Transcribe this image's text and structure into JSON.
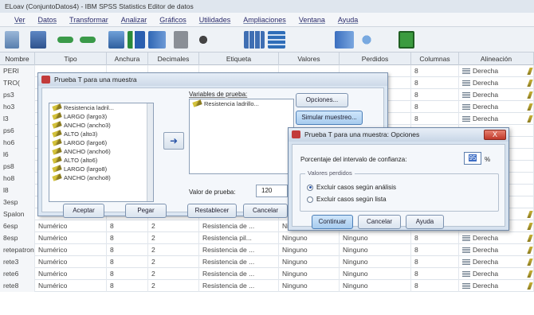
{
  "window": {
    "title": "ELoav (ConjuntoDatos4) - IBM SPSS Statistics Editor de datos"
  },
  "menu": [
    "Ver",
    "Datos",
    "Transformar",
    "Analizar",
    "Gráficos",
    "Utilidades",
    "Ampliaciones",
    "Ventana",
    "Ayuda"
  ],
  "toolbar_icons": [
    "open-icon",
    "save-icon",
    "undo-icon",
    "redo-icon",
    "goto-case-icon",
    "variables-icon",
    "chart-icon",
    "split-icon",
    "find-icon",
    "value-labels-icon",
    "weight-icon",
    "select-icon",
    "dialog-recall-icon"
  ],
  "grid": {
    "columns": [
      "Nombre",
      "Tipo",
      "Anchura",
      "Decimales",
      "Etiqueta",
      "Valores",
      "Perdidos",
      "Columnas",
      "Alineación"
    ],
    "rows": [
      {
        "name": "PERI",
        "tipo": "",
        "anchura": "",
        "decimales": "",
        "etiqueta": "",
        "valores": "",
        "perdidos": "",
        "columnas": "8",
        "alineacion": "Derecha"
      },
      {
        "name": "TRO(",
        "tipo": "",
        "anchura": "",
        "decimales": "",
        "etiqueta": "",
        "valores": "",
        "perdidos": "",
        "columnas": "8",
        "alineacion": "Derecha"
      },
      {
        "name": "ps3",
        "tipo": "",
        "anchura": "",
        "decimales": "",
        "etiqueta": "",
        "valores": "",
        "perdidos": "",
        "columnas": "8",
        "alineacion": "Derecha"
      },
      {
        "name": "ho3",
        "tipo": "",
        "anchura": "",
        "decimales": "",
        "etiqueta": "",
        "valores": "",
        "perdidos": "",
        "columnas": "8",
        "alineacion": "Derecha"
      },
      {
        "name": "l3",
        "tipo": "",
        "anchura": "",
        "decimales": "",
        "etiqueta": "",
        "valores": "",
        "perdidos": "",
        "columnas": "8",
        "alineacion": "Derecha"
      },
      {
        "name": "ps6",
        "tipo": "",
        "anchura": "",
        "decimales": "",
        "etiqueta": "",
        "valores": "",
        "perdidos": "",
        "columnas": "",
        "alineacion": ""
      },
      {
        "name": "ho6",
        "tipo": "",
        "anchura": "",
        "decimales": "",
        "etiqueta": "",
        "valores": "",
        "perdidos": "",
        "columnas": "",
        "alineacion": ""
      },
      {
        "name": "l6",
        "tipo": "",
        "anchura": "",
        "decimales": "",
        "etiqueta": "",
        "valores": "",
        "perdidos": "",
        "columnas": "",
        "alineacion": ""
      },
      {
        "name": "ps8",
        "tipo": "",
        "anchura": "",
        "decimales": "",
        "etiqueta": "",
        "valores": "",
        "perdidos": "",
        "columnas": "",
        "alineacion": ""
      },
      {
        "name": "ho8",
        "tipo": "",
        "anchura": "",
        "decimales": "",
        "etiqueta": "",
        "valores": "",
        "perdidos": "",
        "columnas": "",
        "alineacion": ""
      },
      {
        "name": "l8",
        "tipo": "",
        "anchura": "",
        "decimales": "",
        "etiqueta": "",
        "valores": "",
        "perdidos": "",
        "columnas": "",
        "alineacion": ""
      },
      {
        "name": "3esp",
        "tipo": "",
        "anchura": "",
        "decimales": "",
        "etiqueta": "",
        "valores": "",
        "perdidos": "",
        "columnas": "",
        "alineacion": ""
      },
      {
        "name": "Spalon",
        "tipo": "Numérico",
        "anchura": "8",
        "decimales": "2",
        "etiqueta": "Resistencia de ...",
        "valores": "Ninguno",
        "perdidos": "Ninguno",
        "columnas": "8",
        "alineacion": "Derecha"
      },
      {
        "name": "6esp",
        "tipo": "Numérico",
        "anchura": "8",
        "decimales": "2",
        "etiqueta": "Resistencia de ...",
        "valores": "Ninguno",
        "perdidos": "Ninguno",
        "columnas": "8",
        "alineacion": "Derecha"
      },
      {
        "name": "8esp",
        "tipo": "Numérico",
        "anchura": "8",
        "decimales": "2",
        "etiqueta": "Resistencia pil...",
        "valores": "Ninguno",
        "perdidos": "Ninguno",
        "columnas": "8",
        "alineacion": "Derecha"
      },
      {
        "name": "retepatron",
        "tipo": "Numérico",
        "anchura": "8",
        "decimales": "2",
        "etiqueta": "Resistencia de ...",
        "valores": "Ninguno",
        "perdidos": "Ninguno",
        "columnas": "8",
        "alineacion": "Derecha"
      },
      {
        "name": "rete3",
        "tipo": "Numérico",
        "anchura": "8",
        "decimales": "2",
        "etiqueta": "Resistencia de ...",
        "valores": "Ninguno",
        "perdidos": "Ninguno",
        "columnas": "8",
        "alineacion": "Derecha"
      },
      {
        "name": "rete6",
        "tipo": "Numérico",
        "anchura": "8",
        "decimales": "2",
        "etiqueta": "Resistencia de ...",
        "valores": "Ninguno",
        "perdidos": "Ninguno",
        "columnas": "8",
        "alineacion": "Derecha"
      },
      {
        "name": "rete8",
        "tipo": "Numérico",
        "anchura": "8",
        "decimales": "2",
        "etiqueta": "Resistencia de ...",
        "valores": "Ninguno",
        "perdidos": "Ninguno",
        "columnas": "8",
        "alineacion": "Derecha"
      }
    ]
  },
  "dialog_ttest": {
    "title": "Prueba T para una muestra",
    "source_vars": [
      "Resistencia ladril...",
      "LARGO (largo3)",
      "ANCHO (ancho3)",
      "ALTO (alto3)",
      "LARGO (largo6)",
      "ANCHO (ancho6)",
      "ALTO (alto6)",
      "LARGO (largo8)",
      "ANCHO (ancho8)"
    ],
    "test_vars_label": "Variables de prueba:",
    "test_vars": [
      "Resistencia ladrillo..."
    ],
    "test_value_label": "Valor de prueba:",
    "test_value": "120",
    "buttons": {
      "options": "Opciones...",
      "bootstrap": "Simular muestreo...",
      "ok": "Aceptar",
      "paste": "Pegar",
      "reset": "Restablecer",
      "cancel": "Cancelar"
    }
  },
  "dialog_options": {
    "title": "Prueba T para una muestra: Opciones",
    "close": "X",
    "ci_label": "Porcentaje del intervalo de confianza:",
    "ci_value": "95",
    "ci_unit": "%",
    "missing_title": "Valores perdidos",
    "radio_analysis": "Excluir casos según análisis",
    "radio_listwise": "Excluir casos según lista",
    "radio_selected": "analysis",
    "buttons": {
      "continue": "Continuar",
      "cancel": "Cancelar",
      "help": "Ayuda"
    }
  }
}
